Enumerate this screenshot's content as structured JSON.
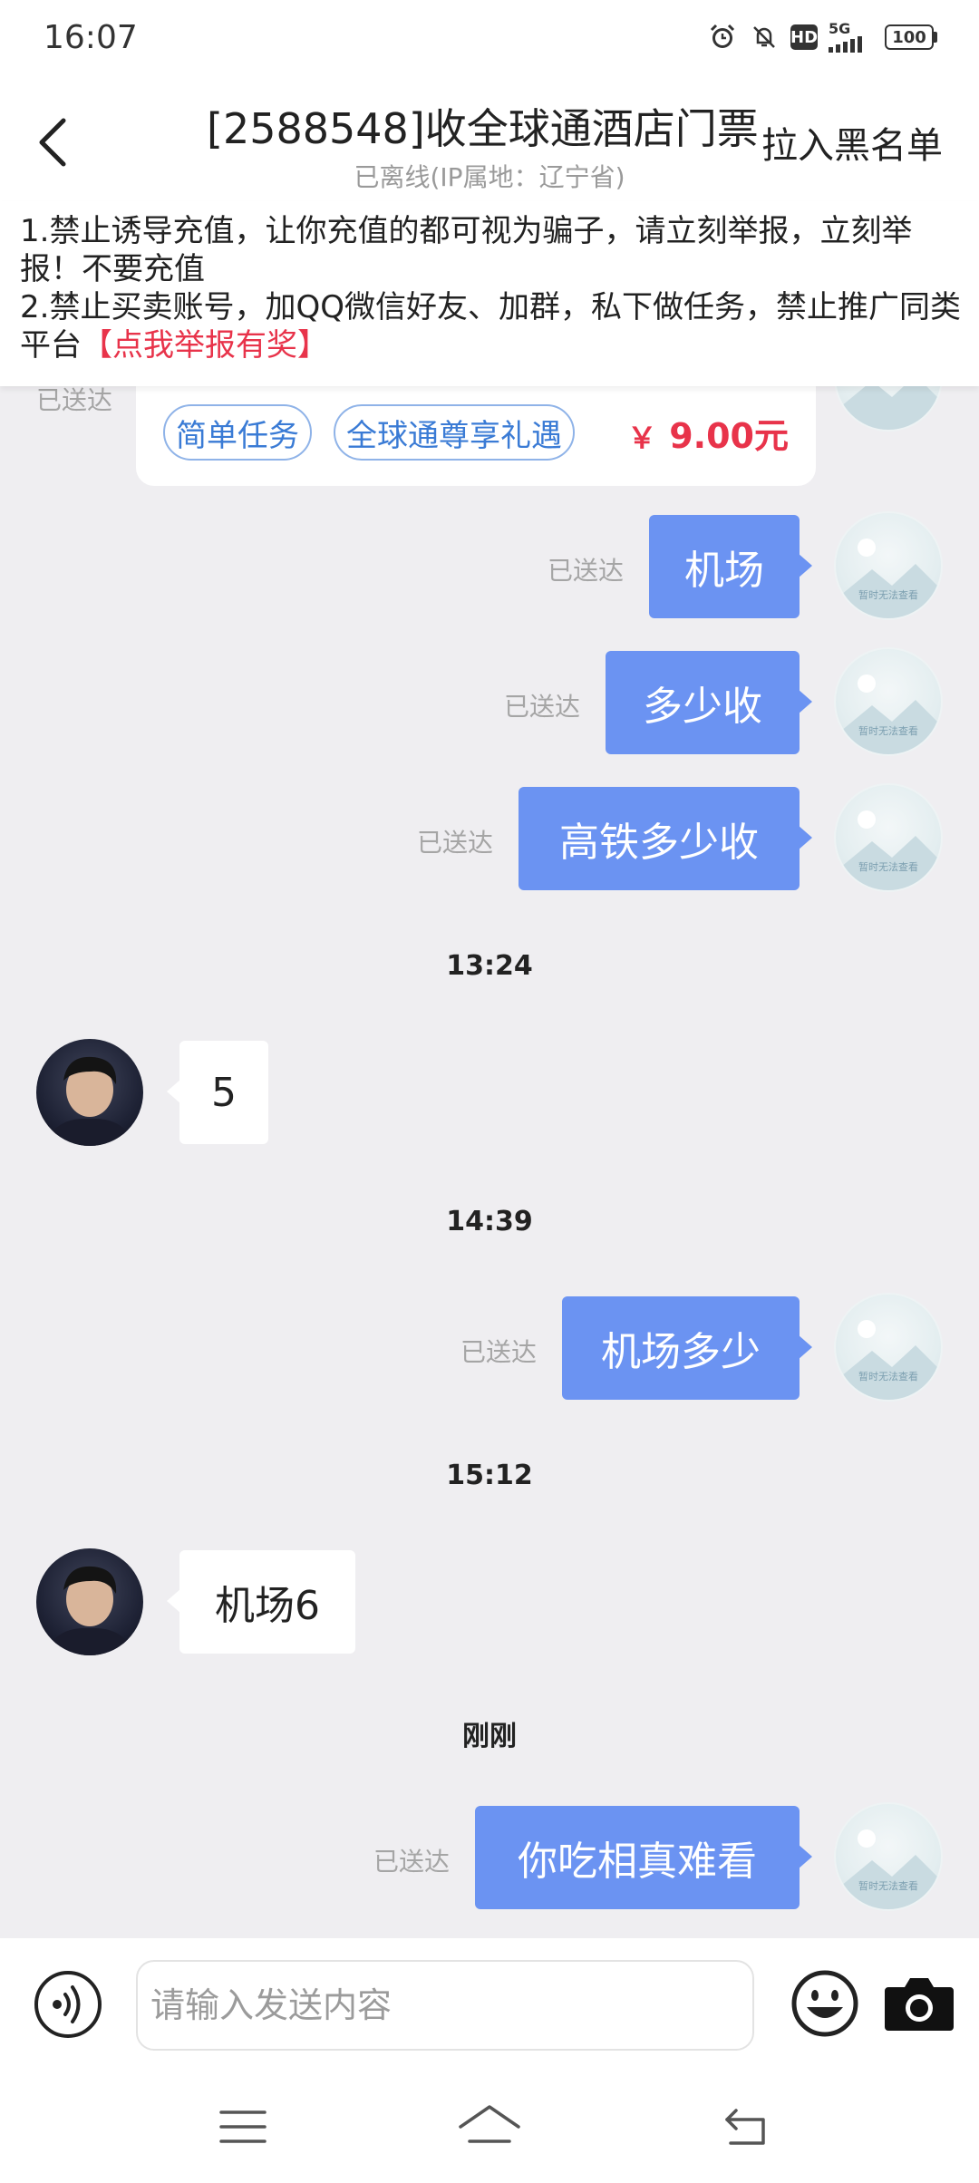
{
  "status_bar": {
    "time": "16:07",
    "network": "5G",
    "hd": "HD",
    "battery": "100",
    "icons": [
      "alarm-icon",
      "bell-muted-icon",
      "hd-icon",
      "signal-icon",
      "battery-icon"
    ]
  },
  "header": {
    "title": "[2588548]收全球通酒店门票",
    "subtitle": "已离线(IP属地：辽宁省)",
    "blacklist": "拉入黑名单"
  },
  "notice": {
    "line1": "1.禁止诱导充值，让你充值的都可视为骗子，请立刻举报，立刻举报！不要充值",
    "line2": "2.禁止买卖账号，加QQ微信好友、加群，私下做任务，禁止推广同类平台",
    "report_link": "【点我举报有奖】"
  },
  "task_card": {
    "sent_status": "已送达",
    "tags": [
      "简单任务",
      "全球通尊享礼遇"
    ],
    "currency": "￥",
    "price": "9.00元"
  },
  "messages": [
    {
      "text": "机场",
      "status": "已送达"
    },
    {
      "text": "多少收",
      "status": "已送达"
    },
    {
      "text": "高铁多少收",
      "status": "已送达"
    },
    {
      "timestamp": "13:24"
    },
    {
      "text": "5"
    },
    {
      "timestamp": "14:39"
    },
    {
      "text": "机场多少",
      "status": "已送达"
    },
    {
      "timestamp": "15:12"
    },
    {
      "text": "机场6"
    },
    {
      "timestamp": "刚刚"
    },
    {
      "text": "你吃相真难看",
      "status": "已送达"
    }
  ],
  "avatar_placeholder": "暂时无法查看",
  "input": {
    "placeholder": "请输入发送内容"
  },
  "colors": {
    "bubble_out": "#6b93f2",
    "price": "#e8334a",
    "report_link": "#e8334a",
    "tag_border": "#8fb3e8",
    "background": "#efeef1"
  }
}
